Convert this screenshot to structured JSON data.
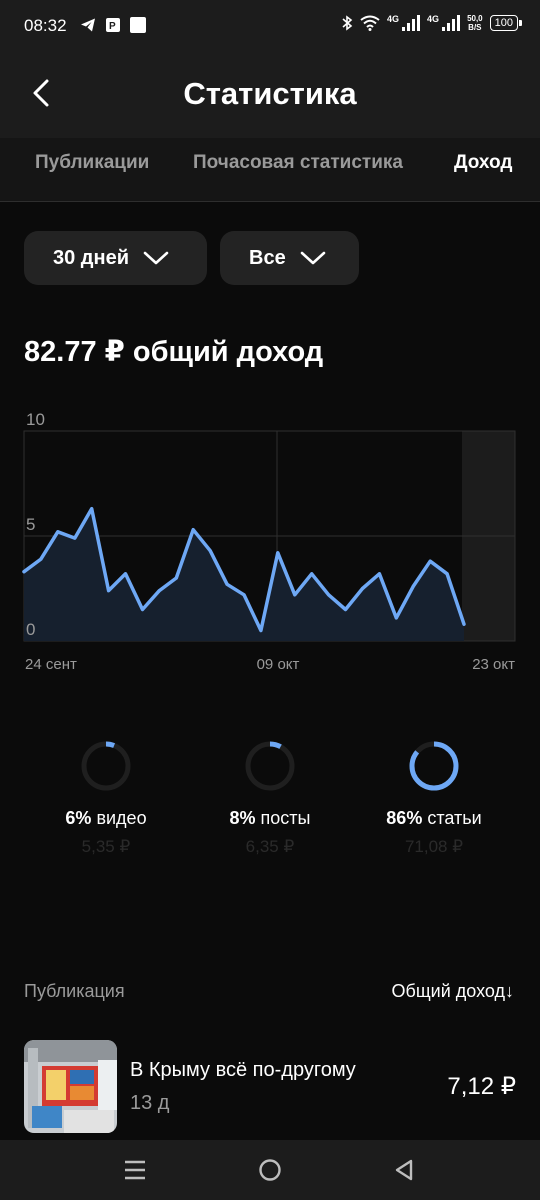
{
  "status_bar": {
    "time": "08:32",
    "network_1": "4G",
    "network_2": "4G",
    "speed_value": "50,0",
    "speed_unit": "B/S",
    "battery": "100",
    "icons": [
      "telegram-icon",
      "app-p-icon",
      "square-app-icon",
      "bluetooth-icon",
      "wifi-icon",
      "signal-icon",
      "battery-icon"
    ]
  },
  "header": {
    "title": "Статистика",
    "back_icon": "back-arrow-icon"
  },
  "tabs": [
    {
      "label": "Публикации",
      "active": false
    },
    {
      "label": "Почасовая статистика",
      "active": false
    },
    {
      "label": "Доход",
      "active": true
    }
  ],
  "filters": {
    "period": "30 дней",
    "type": "Все"
  },
  "summary": {
    "total": "82.77 ₽ общий доход"
  },
  "chart_data": {
    "type": "area",
    "y_ticks": [
      "10",
      "5",
      "0"
    ],
    "x_ticks": [
      "24 сент",
      "09 окт",
      "23 окт"
    ],
    "ylim": [
      0,
      10
    ],
    "series": [
      {
        "values": [
          3.3,
          3.9,
          5.2,
          4.9,
          6.3,
          2.4,
          3.2,
          1.5,
          2.4,
          3.0,
          5.3,
          4.3,
          2.7,
          2.2,
          0.5,
          4.2,
          2.2,
          3.2,
          2.2,
          1.5,
          2.5,
          3.2,
          1.1,
          2.6,
          3.8,
          3.2,
          0.8
        ]
      }
    ],
    "line_color": "#6ea8f5",
    "grid": true
  },
  "breakdown": [
    {
      "percent": "6%",
      "label": "видео",
      "amount": "5,35 ₽",
      "fraction": 0.06
    },
    {
      "percent": "8%",
      "label": "посты",
      "amount": "6,35 ₽",
      "fraction": 0.08
    },
    {
      "percent": "86%",
      "label": "статьи",
      "amount": "71,08 ₽",
      "fraction": 0.86
    }
  ],
  "list": {
    "column_left": "Публикация",
    "column_right": "Общий доход↓",
    "items": [
      {
        "title": "В Крыму всё по-другому",
        "age": "13 д",
        "income": "7,12 ₽"
      }
    ]
  },
  "colors": {
    "accent": "#6ea8f5",
    "background": "#0b0b0b",
    "surface": "#1c1c1c",
    "chip": "#232323"
  },
  "nav": {
    "icons": [
      "menu-icon",
      "home-circle-icon",
      "back-triangle-icon"
    ]
  }
}
